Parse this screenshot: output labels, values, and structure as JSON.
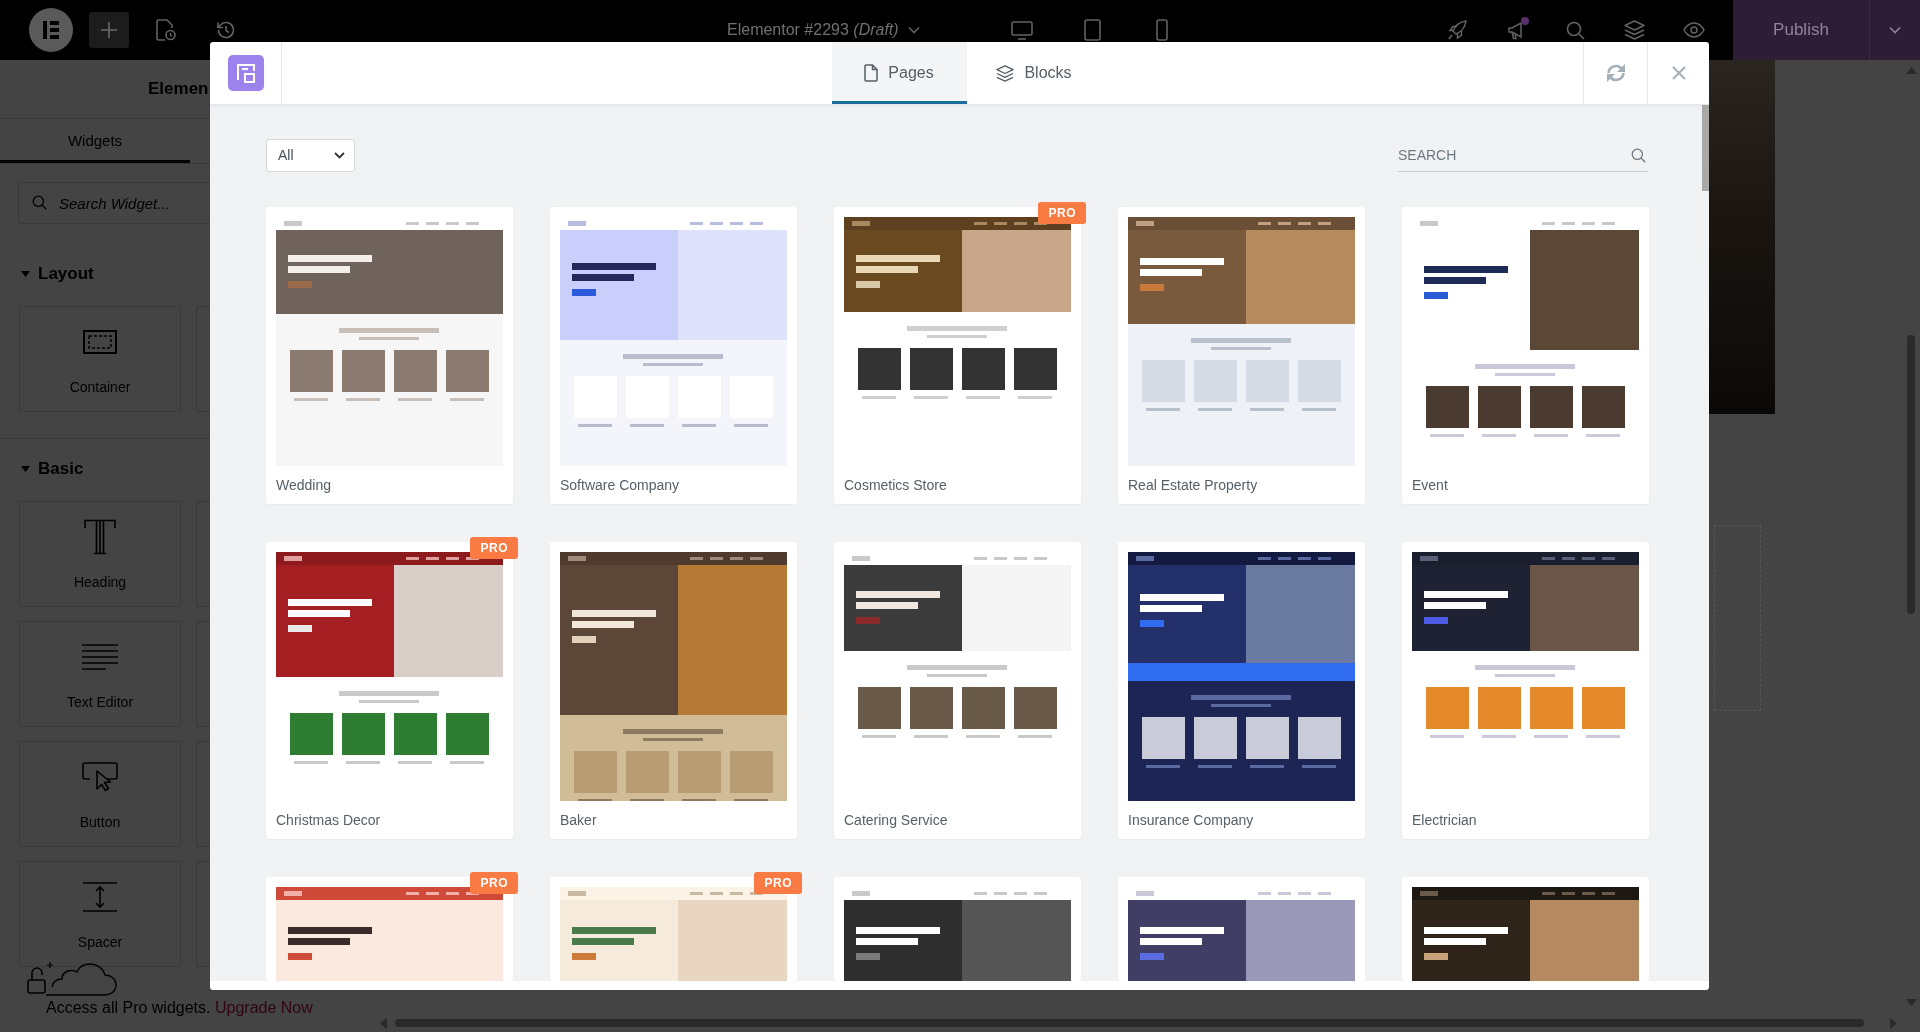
{
  "topbar": {
    "document_title": "Elementor #2293 *(Draft)*",
    "publish": "Publish"
  },
  "panel": {
    "title": "Elemen",
    "tabs": [
      {
        "label": "Widgets",
        "selected": true
      }
    ],
    "search": {
      "placeholder": "Search Widget..."
    },
    "categories": [
      {
        "label": "Layout",
        "expanded": true,
        "widgets": [
          {
            "label": "Container",
            "kind": "container"
          }
        ]
      },
      {
        "label": "Basic",
        "expanded": true,
        "widgets": [
          {
            "label": "Heading",
            "kind": "heading"
          },
          {
            "label": "Text Editor",
            "kind": "text"
          },
          {
            "label": "Button",
            "kind": "button"
          },
          {
            "label": "Spacer",
            "kind": "spacer"
          }
        ]
      }
    ],
    "promo": {
      "text": "Access all Pro widgets.",
      "link": "Upgrade Now"
    }
  },
  "library": {
    "tabs": [
      {
        "label": "Pages",
        "kind": "pages",
        "selected": true
      },
      {
        "label": "Blocks",
        "kind": "blocks",
        "selected": false
      }
    ],
    "filter": {
      "value": "All"
    },
    "search": {
      "placeholder": "SEARCH"
    },
    "templates": [
      {
        "name": "Wedding",
        "pro": false
      },
      {
        "name": "Software Company",
        "pro": false
      },
      {
        "name": "Cosmetics Store",
        "pro": true,
        "badge": "PRO"
      },
      {
        "name": "Real Estate Property",
        "pro": false
      },
      {
        "name": "Event",
        "pro": false
      },
      {
        "name": "Christmas Decor",
        "pro": true,
        "badge": "PRO"
      },
      {
        "name": "Baker",
        "pro": false
      },
      {
        "name": "Catering Service",
        "pro": false
      },
      {
        "name": "Insurance Company",
        "pro": false
      },
      {
        "name": "Electrician",
        "pro": false
      },
      {
        "pro": true,
        "badge": "PRO"
      },
      {
        "pro": true,
        "badge": "PRO"
      },
      {
        "pro": false
      },
      {
        "pro": false
      },
      {
        "pro": false
      }
    ]
  }
}
